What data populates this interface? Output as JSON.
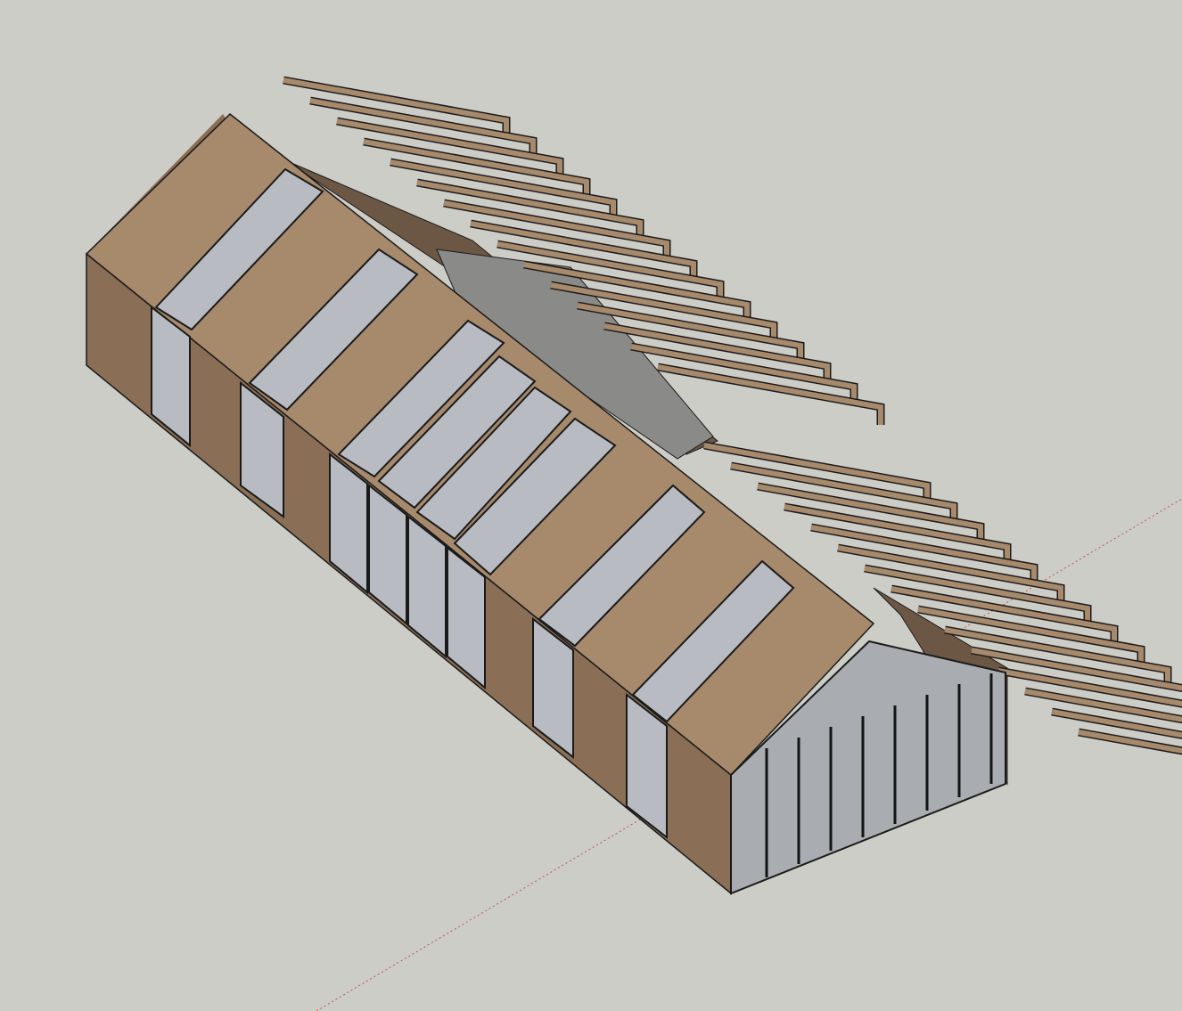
{
  "app": {
    "name": ""
  },
  "viewport": {
    "background": "#cdcdc8",
    "axis_color": "#c0504d",
    "wood_color": "#a7896c",
    "wood_dark": "#6b5744",
    "glass_color": "#b8bcc2",
    "frame_color": "#141414",
    "edge_color": "#1a1a1a"
  },
  "model": {
    "type": "isometric-3d-building",
    "components": [
      "rafter-array-upper",
      "rafter-array-lower",
      "roof-panels",
      "skylights",
      "side-windows",
      "gable-glazing"
    ]
  }
}
